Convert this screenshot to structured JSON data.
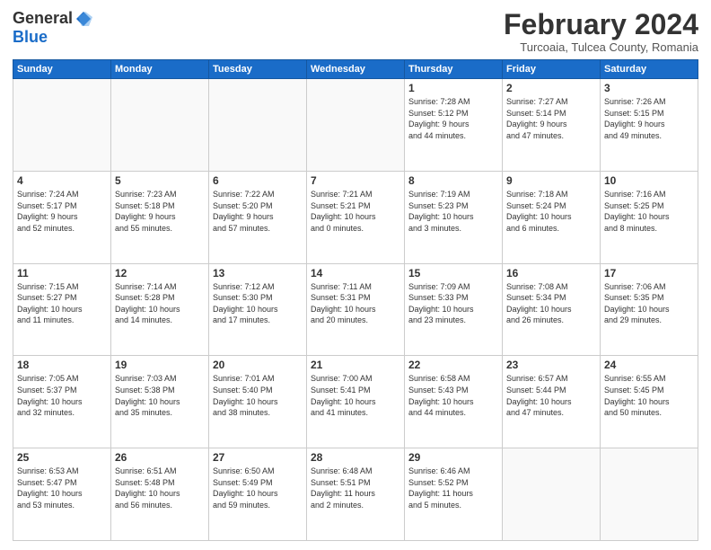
{
  "header": {
    "logo_general": "General",
    "logo_blue": "Blue",
    "month_title": "February 2024",
    "subtitle": "Turcoaia, Tulcea County, Romania"
  },
  "weekdays": [
    "Sunday",
    "Monday",
    "Tuesday",
    "Wednesday",
    "Thursday",
    "Friday",
    "Saturday"
  ],
  "weeks": [
    [
      {
        "day": "",
        "info": ""
      },
      {
        "day": "",
        "info": ""
      },
      {
        "day": "",
        "info": ""
      },
      {
        "day": "",
        "info": ""
      },
      {
        "day": "1",
        "info": "Sunrise: 7:28 AM\nSunset: 5:12 PM\nDaylight: 9 hours\nand 44 minutes."
      },
      {
        "day": "2",
        "info": "Sunrise: 7:27 AM\nSunset: 5:14 PM\nDaylight: 9 hours\nand 47 minutes."
      },
      {
        "day": "3",
        "info": "Sunrise: 7:26 AM\nSunset: 5:15 PM\nDaylight: 9 hours\nand 49 minutes."
      }
    ],
    [
      {
        "day": "4",
        "info": "Sunrise: 7:24 AM\nSunset: 5:17 PM\nDaylight: 9 hours\nand 52 minutes."
      },
      {
        "day": "5",
        "info": "Sunrise: 7:23 AM\nSunset: 5:18 PM\nDaylight: 9 hours\nand 55 minutes."
      },
      {
        "day": "6",
        "info": "Sunrise: 7:22 AM\nSunset: 5:20 PM\nDaylight: 9 hours\nand 57 minutes."
      },
      {
        "day": "7",
        "info": "Sunrise: 7:21 AM\nSunset: 5:21 PM\nDaylight: 10 hours\nand 0 minutes."
      },
      {
        "day": "8",
        "info": "Sunrise: 7:19 AM\nSunset: 5:23 PM\nDaylight: 10 hours\nand 3 minutes."
      },
      {
        "day": "9",
        "info": "Sunrise: 7:18 AM\nSunset: 5:24 PM\nDaylight: 10 hours\nand 6 minutes."
      },
      {
        "day": "10",
        "info": "Sunrise: 7:16 AM\nSunset: 5:25 PM\nDaylight: 10 hours\nand 8 minutes."
      }
    ],
    [
      {
        "day": "11",
        "info": "Sunrise: 7:15 AM\nSunset: 5:27 PM\nDaylight: 10 hours\nand 11 minutes."
      },
      {
        "day": "12",
        "info": "Sunrise: 7:14 AM\nSunset: 5:28 PM\nDaylight: 10 hours\nand 14 minutes."
      },
      {
        "day": "13",
        "info": "Sunrise: 7:12 AM\nSunset: 5:30 PM\nDaylight: 10 hours\nand 17 minutes."
      },
      {
        "day": "14",
        "info": "Sunrise: 7:11 AM\nSunset: 5:31 PM\nDaylight: 10 hours\nand 20 minutes."
      },
      {
        "day": "15",
        "info": "Sunrise: 7:09 AM\nSunset: 5:33 PM\nDaylight: 10 hours\nand 23 minutes."
      },
      {
        "day": "16",
        "info": "Sunrise: 7:08 AM\nSunset: 5:34 PM\nDaylight: 10 hours\nand 26 minutes."
      },
      {
        "day": "17",
        "info": "Sunrise: 7:06 AM\nSunset: 5:35 PM\nDaylight: 10 hours\nand 29 minutes."
      }
    ],
    [
      {
        "day": "18",
        "info": "Sunrise: 7:05 AM\nSunset: 5:37 PM\nDaylight: 10 hours\nand 32 minutes."
      },
      {
        "day": "19",
        "info": "Sunrise: 7:03 AM\nSunset: 5:38 PM\nDaylight: 10 hours\nand 35 minutes."
      },
      {
        "day": "20",
        "info": "Sunrise: 7:01 AM\nSunset: 5:40 PM\nDaylight: 10 hours\nand 38 minutes."
      },
      {
        "day": "21",
        "info": "Sunrise: 7:00 AM\nSunset: 5:41 PM\nDaylight: 10 hours\nand 41 minutes."
      },
      {
        "day": "22",
        "info": "Sunrise: 6:58 AM\nSunset: 5:43 PM\nDaylight: 10 hours\nand 44 minutes."
      },
      {
        "day": "23",
        "info": "Sunrise: 6:57 AM\nSunset: 5:44 PM\nDaylight: 10 hours\nand 47 minutes."
      },
      {
        "day": "24",
        "info": "Sunrise: 6:55 AM\nSunset: 5:45 PM\nDaylight: 10 hours\nand 50 minutes."
      }
    ],
    [
      {
        "day": "25",
        "info": "Sunrise: 6:53 AM\nSunset: 5:47 PM\nDaylight: 10 hours\nand 53 minutes."
      },
      {
        "day": "26",
        "info": "Sunrise: 6:51 AM\nSunset: 5:48 PM\nDaylight: 10 hours\nand 56 minutes."
      },
      {
        "day": "27",
        "info": "Sunrise: 6:50 AM\nSunset: 5:49 PM\nDaylight: 10 hours\nand 59 minutes."
      },
      {
        "day": "28",
        "info": "Sunrise: 6:48 AM\nSunset: 5:51 PM\nDaylight: 11 hours\nand 2 minutes."
      },
      {
        "day": "29",
        "info": "Sunrise: 6:46 AM\nSunset: 5:52 PM\nDaylight: 11 hours\nand 5 minutes."
      },
      {
        "day": "",
        "info": ""
      },
      {
        "day": "",
        "info": ""
      }
    ]
  ]
}
